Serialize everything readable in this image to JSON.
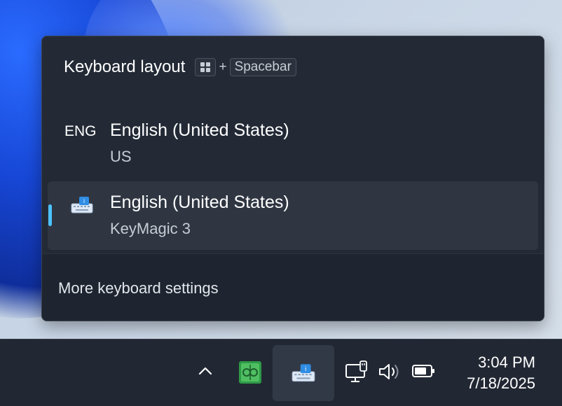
{
  "flyout": {
    "title": "Keyboard layout",
    "shortcut_plus": "+",
    "shortcut_key": "Spacebar",
    "items": [
      {
        "badge": "ENG",
        "name": "English (United States)",
        "sub": "US",
        "selected": false
      },
      {
        "badge_icon": "keymagic-keyboard-icon",
        "name": "English (United States)",
        "sub": "KeyMagic 3",
        "selected": true
      }
    ],
    "footer_link": "More keyboard settings"
  },
  "taskbar": {
    "time": "3:04 PM",
    "date": "7/18/2025",
    "icons": [
      "chevron-up-icon",
      "app-green-icon",
      "keymagic-keyboard-icon",
      "network-icon",
      "volume-icon",
      "battery-icon"
    ]
  },
  "colors": {
    "flyout_bg": "#232a36",
    "selected_bg": "#2f3642",
    "accent": "#4cc2ff",
    "taskbar_bg": "#222833"
  }
}
